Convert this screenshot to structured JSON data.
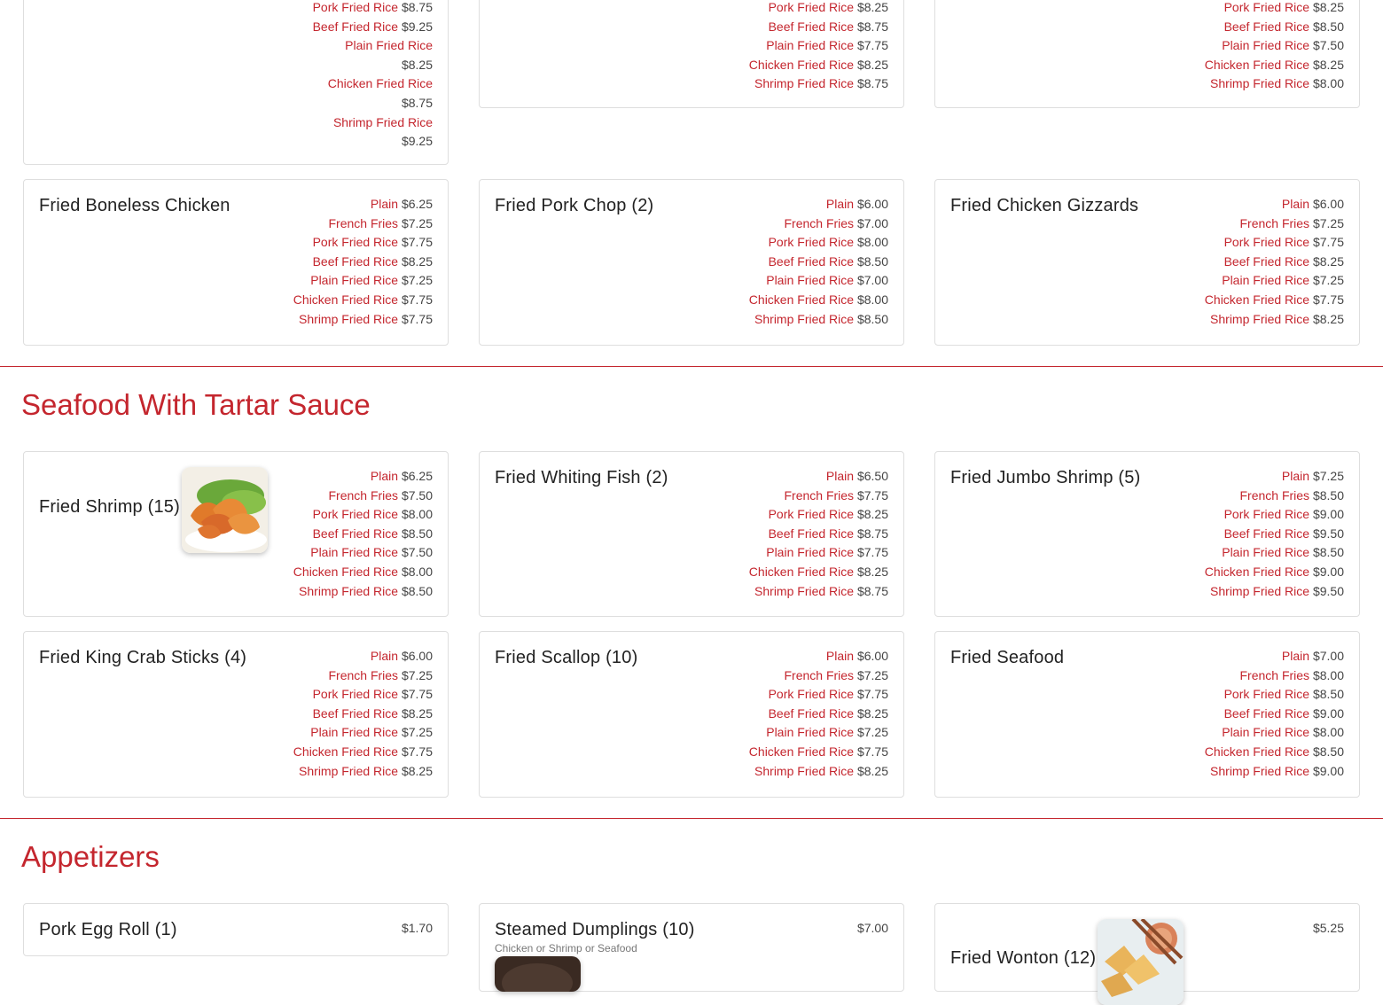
{
  "sections": [
    {
      "title": "Seafood With Tartar Sauce"
    },
    {
      "title": "Appetizers"
    }
  ],
  "colors": {
    "accent": "#c4262e",
    "card_border": "#dedede"
  },
  "cards": {
    "top1": {
      "prices": [
        {
          "option": "Pork Fried Rice",
          "price": "$8.75"
        },
        {
          "option": "Beef Fried Rice",
          "price": "$9.25"
        },
        {
          "option": "Plain Fried Rice",
          "price": "$8.25"
        },
        {
          "option": "Chicken Fried Rice",
          "price": "$8.75"
        },
        {
          "option": "Shrimp Fried Rice",
          "price": "$9.25"
        }
      ]
    },
    "top2": {
      "prices": [
        {
          "option": "Pork Fried Rice",
          "price": "$8.25"
        },
        {
          "option": "Beef Fried Rice",
          "price": "$8.75"
        },
        {
          "option": "Plain Fried Rice",
          "price": "$7.75"
        },
        {
          "option": "Chicken Fried Rice",
          "price": "$8.25"
        },
        {
          "option": "Shrimp Fried Rice",
          "price": "$8.75"
        }
      ]
    },
    "top3": {
      "prices": [
        {
          "option": "Pork Fried Rice",
          "price": "$8.25"
        },
        {
          "option": "Beef Fried Rice",
          "price": "$8.50"
        },
        {
          "option": "Plain Fried Rice",
          "price": "$7.50"
        },
        {
          "option": "Chicken Fried Rice",
          "price": "$8.25"
        },
        {
          "option": "Shrimp Fried Rice",
          "price": "$8.00"
        }
      ]
    },
    "boneless_chicken": {
      "name": "Fried Boneless Chicken",
      "prices": [
        {
          "option": "Plain",
          "price": "$6.25"
        },
        {
          "option": "French Fries",
          "price": "$7.25"
        },
        {
          "option": "Pork Fried Rice",
          "price": "$7.75"
        },
        {
          "option": "Beef Fried Rice",
          "price": "$8.25"
        },
        {
          "option": "Plain Fried Rice",
          "price": "$7.25"
        },
        {
          "option": "Chicken Fried Rice",
          "price": "$7.75"
        },
        {
          "option": "Shrimp Fried Rice",
          "price": "$7.75"
        }
      ]
    },
    "pork_chop": {
      "name": "Fried Pork Chop (2)",
      "prices": [
        {
          "option": "Plain",
          "price": "$6.00"
        },
        {
          "option": "French Fries",
          "price": "$7.00"
        },
        {
          "option": "Pork Fried Rice",
          "price": "$8.00"
        },
        {
          "option": "Beef Fried Rice",
          "price": "$8.50"
        },
        {
          "option": "Plain Fried Rice",
          "price": "$7.00"
        },
        {
          "option": "Chicken Fried Rice",
          "price": "$8.00"
        },
        {
          "option": "Shrimp Fried Rice",
          "price": "$8.50"
        }
      ]
    },
    "gizzards": {
      "name": "Fried Chicken Gizzards",
      "prices": [
        {
          "option": "Plain",
          "price": "$6.00"
        },
        {
          "option": "French Fries",
          "price": "$7.25"
        },
        {
          "option": "Pork Fried Rice",
          "price": "$7.75"
        },
        {
          "option": "Beef Fried Rice",
          "price": "$8.25"
        },
        {
          "option": "Plain Fried Rice",
          "price": "$7.25"
        },
        {
          "option": "Chicken Fried Rice",
          "price": "$7.75"
        },
        {
          "option": "Shrimp Fried Rice",
          "price": "$8.25"
        }
      ]
    },
    "fried_shrimp": {
      "name": "Fried Shrimp (15)",
      "prices": [
        {
          "option": "Plain",
          "price": "$6.25"
        },
        {
          "option": "French Fries",
          "price": "$7.50"
        },
        {
          "option": "Pork Fried Rice",
          "price": "$8.00"
        },
        {
          "option": "Beef Fried Rice",
          "price": "$8.50"
        },
        {
          "option": "Plain Fried Rice",
          "price": "$7.50"
        },
        {
          "option": "Chicken Fried Rice",
          "price": "$8.00"
        },
        {
          "option": "Shrimp Fried Rice",
          "price": "$8.50"
        }
      ]
    },
    "whiting_fish": {
      "name": "Fried Whiting Fish (2)",
      "prices": [
        {
          "option": "Plain",
          "price": "$6.50"
        },
        {
          "option": "French Fries",
          "price": "$7.75"
        },
        {
          "option": "Pork Fried Rice",
          "price": "$8.25"
        },
        {
          "option": "Beef Fried Rice",
          "price": "$8.75"
        },
        {
          "option": "Plain Fried Rice",
          "price": "$7.75"
        },
        {
          "option": "Chicken Fried Rice",
          "price": "$8.25"
        },
        {
          "option": "Shrimp Fried Rice",
          "price": "$8.75"
        }
      ]
    },
    "jumbo_shrimp": {
      "name": "Fried Jumbo Shrimp (5)",
      "prices": [
        {
          "option": "Plain",
          "price": "$7.25"
        },
        {
          "option": "French Fries",
          "price": "$8.50"
        },
        {
          "option": "Pork Fried Rice",
          "price": "$9.00"
        },
        {
          "option": "Beef Fried Rice",
          "price": "$9.50"
        },
        {
          "option": "Plain Fried Rice",
          "price": "$8.50"
        },
        {
          "option": "Chicken Fried Rice",
          "price": "$9.00"
        },
        {
          "option": "Shrimp Fried Rice",
          "price": "$9.50"
        }
      ]
    },
    "crab_sticks": {
      "name": "Fried King Crab Sticks (4)",
      "prices": [
        {
          "option": "Plain",
          "price": "$6.00"
        },
        {
          "option": "French Fries",
          "price": "$7.25"
        },
        {
          "option": "Pork Fried Rice",
          "price": "$7.75"
        },
        {
          "option": "Beef Fried Rice",
          "price": "$8.25"
        },
        {
          "option": "Plain Fried Rice",
          "price": "$7.25"
        },
        {
          "option": "Chicken Fried Rice",
          "price": "$7.75"
        },
        {
          "option": "Shrimp Fried Rice",
          "price": "$8.25"
        }
      ]
    },
    "scallop": {
      "name": "Fried Scallop (10)",
      "prices": [
        {
          "option": "Plain",
          "price": "$6.00"
        },
        {
          "option": "French Fries",
          "price": "$7.25"
        },
        {
          "option": "Pork Fried Rice",
          "price": "$7.75"
        },
        {
          "option": "Beef Fried Rice",
          "price": "$8.25"
        },
        {
          "option": "Plain Fried Rice",
          "price": "$7.25"
        },
        {
          "option": "Chicken Fried Rice",
          "price": "$7.75"
        },
        {
          "option": "Shrimp Fried Rice",
          "price": "$8.25"
        }
      ]
    },
    "seafood": {
      "name": "Fried Seafood",
      "prices": [
        {
          "option": "Plain",
          "price": "$7.00"
        },
        {
          "option": "French Fries",
          "price": "$8.00"
        },
        {
          "option": "Pork Fried Rice",
          "price": "$8.50"
        },
        {
          "option": "Beef Fried Rice",
          "price": "$9.00"
        },
        {
          "option": "Plain Fried Rice",
          "price": "$8.00"
        },
        {
          "option": "Chicken Fried Rice",
          "price": "$8.50"
        },
        {
          "option": "Shrimp Fried Rice",
          "price": "$9.00"
        }
      ]
    },
    "egg_roll": {
      "name": "Pork Egg Roll (1)",
      "price": "$1.70"
    },
    "dumplings": {
      "name": "Steamed Dumplings (10)",
      "description": "Chicken or Shrimp or Seafood",
      "price": "$7.00"
    },
    "wonton": {
      "name": "Fried Wonton (12)",
      "price": "$5.25"
    }
  }
}
